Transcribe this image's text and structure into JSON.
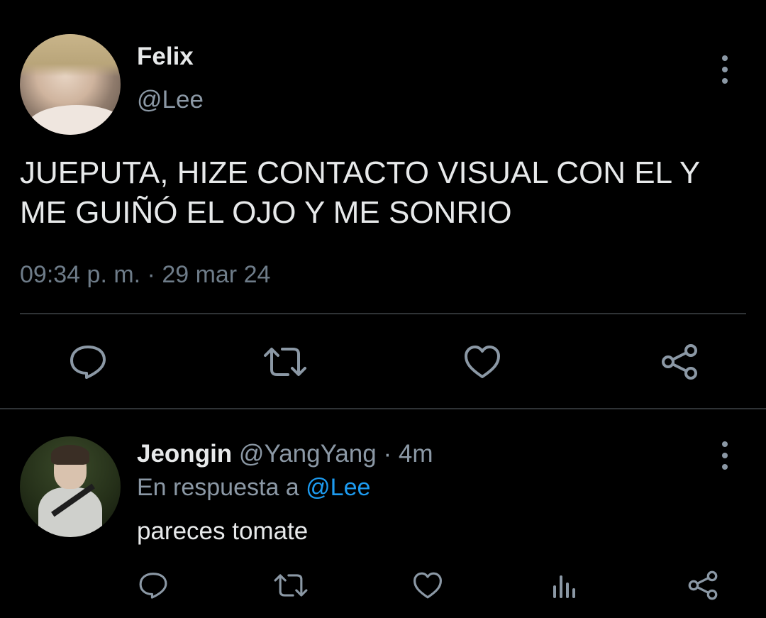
{
  "main_tweet": {
    "display_name": "Felix",
    "handle": "@Lee",
    "text": "JUEPUTA, HIZE CONTACTO VISUAL CON EL Y\nME GUIÑÓ EL OJO Y ME SONRIO",
    "timestamp": "09:34 p. m. · 29 mar 24",
    "actions": [
      "reply-icon",
      "retweet-icon",
      "like-icon",
      "share-icon"
    ]
  },
  "reply_tweet": {
    "display_name": "Jeongin",
    "handle": "@YangYang",
    "separator": "·",
    "age": "4m",
    "reply_prefix": "En respuesta a",
    "reply_mention": "@Lee",
    "text": "pareces tomate",
    "actions": [
      "reply-icon",
      "retweet-icon",
      "like-icon",
      "stats-icon",
      "share-icon"
    ]
  },
  "colors": {
    "background": "#000000",
    "primary_text": "#e7e9ea",
    "secondary_text": "#8b98a5",
    "link": "#1d9bf0",
    "divider": "#2f3336"
  }
}
